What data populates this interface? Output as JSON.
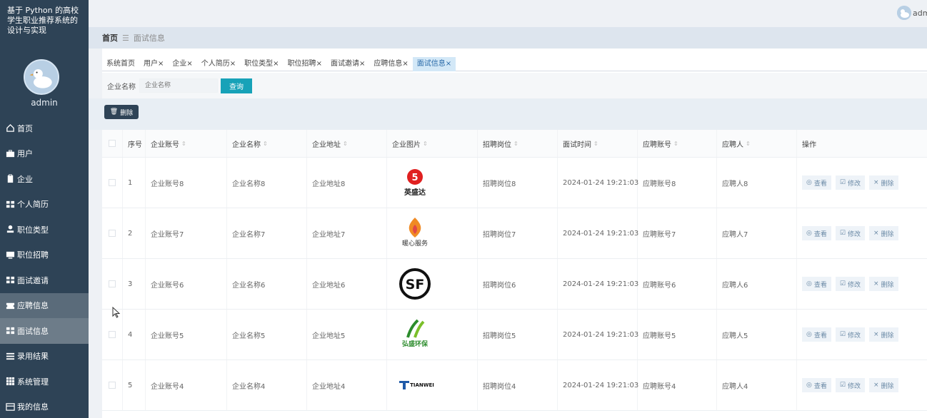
{
  "app": {
    "title": "基于 Python 的高校学生职业推荐系统的设计与实现"
  },
  "sidebar": {
    "admin_name": "admin",
    "items": [
      {
        "label": "首页",
        "icon": "home-icon"
      },
      {
        "label": "用户",
        "icon": "briefcase-icon"
      },
      {
        "label": "企业",
        "icon": "clipboard-icon"
      },
      {
        "label": "个人简历",
        "icon": "grid-icon"
      },
      {
        "label": "职位类型",
        "icon": "person-icon"
      },
      {
        "label": "职位招聘",
        "icon": "monitor-icon"
      },
      {
        "label": "面试邀请",
        "icon": "grid-icon"
      },
      {
        "label": "应聘信息",
        "icon": "ticket-icon"
      },
      {
        "label": "面试信息",
        "icon": "grid-icon"
      },
      {
        "label": "录用结果",
        "icon": "list-icon"
      },
      {
        "label": "系统管理",
        "icon": "apps-icon"
      },
      {
        "label": "我的信息",
        "icon": "card-icon"
      }
    ]
  },
  "header": {
    "user_name": "admin"
  },
  "breadcrumb": {
    "home": "首页",
    "separator": "☰",
    "current": "面试信息"
  },
  "tabs": [
    {
      "label": "系统首页",
      "closable": false
    },
    {
      "label": "用户",
      "closable": true
    },
    {
      "label": "企业",
      "closable": true
    },
    {
      "label": "个人简历",
      "closable": true
    },
    {
      "label": "职位类型",
      "closable": true
    },
    {
      "label": "职位招聘",
      "closable": true
    },
    {
      "label": "面试邀请",
      "closable": true
    },
    {
      "label": "应聘信息",
      "closable": true
    },
    {
      "label": "面试信息",
      "closable": true
    }
  ],
  "search": {
    "label": "企业名称",
    "placeholder": "企业名称",
    "button": "查询"
  },
  "actions": {
    "delete": "删除"
  },
  "table": {
    "columns": [
      "序号",
      "企业账号",
      "企业名称",
      "企业地址",
      "企业图片",
      "招聘岗位",
      "面试时间",
      "应聘账号",
      "应聘人",
      "操作"
    ],
    "sortable": [
      false,
      true,
      true,
      true,
      true,
      true,
      true,
      true,
      true,
      false
    ],
    "op_labels": {
      "view": "查看",
      "edit": "修改",
      "delete": "删除"
    },
    "rows": [
      {
        "idx": "1",
        "acct": "企业账号8",
        "name": "企业名称8",
        "addr": "企业地址8",
        "logo": "yingshengda",
        "logo_text": "英盛达",
        "pos": "招聘岗位8",
        "time": "2024-01-24 19:21:03",
        "racct": "应聘账号8",
        "rname": "应聘人8"
      },
      {
        "idx": "2",
        "acct": "企业账号7",
        "name": "企业名称7",
        "addr": "企业地址7",
        "logo": "nuanxin",
        "logo_text": "暖心服务",
        "pos": "招聘岗位7",
        "time": "2024-01-24 19:21:03",
        "racct": "应聘账号7",
        "rname": "应聘人7"
      },
      {
        "idx": "3",
        "acct": "企业账号6",
        "name": "企业名称6",
        "addr": "企业地址6",
        "logo": "sf",
        "logo_text": "SF",
        "pos": "招聘岗位6",
        "time": "2024-01-24 19:21:03",
        "racct": "应聘账号6",
        "rname": "应聘人6"
      },
      {
        "idx": "4",
        "acct": "企业账号5",
        "name": "企业名称5",
        "addr": "企业地址5",
        "logo": "hongsheng",
        "logo_text": "弘盛环保",
        "pos": "招聘岗位5",
        "time": "2024-01-24 19:21:03",
        "racct": "应聘账号5",
        "rname": "应聘人5"
      },
      {
        "idx": "5",
        "acct": "企业账号4",
        "name": "企业名称4",
        "addr": "企业地址4",
        "logo": "tianwei",
        "logo_text": "TIANWEI",
        "pos": "招聘岗位4",
        "time": "2024-01-24 19:21:03",
        "racct": "应聘账号4",
        "rname": "应聘人4"
      }
    ]
  },
  "colors": {
    "sidebar": "#2e4356",
    "accent": "#17a2b8",
    "active_tab": "#d3e8f7"
  }
}
